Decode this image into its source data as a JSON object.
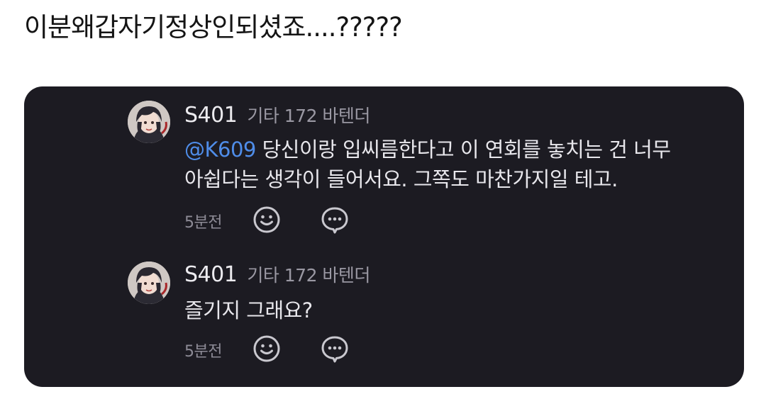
{
  "caption": "이분왜갑자기정상인되셨죠....?????",
  "comments": [
    {
      "username": "S401",
      "meta": "기타 172 바텐더",
      "mention": "@K609",
      "text_line1": " 당신이랑 입씨름한다고 이 연회를 놓치는 건 너무",
      "text_line2": "아쉽다는 생각이 들어서요. 그쪽도 마찬가지일 테고.",
      "time": "5분전",
      "reaction_icon": "smile-icon",
      "reply_icon": "chat-bubble-icon"
    },
    {
      "username": "S401",
      "meta": "기타 172 바텐더",
      "text_line1": "즐기지 그래요?",
      "time": "5분전",
      "reaction_icon": "smile-icon",
      "reply_icon": "chat-bubble-icon"
    }
  ],
  "colors": {
    "card_background": "#1c1b22",
    "mention": "#4f8de9",
    "icon_stroke": "#c9c8cf"
  }
}
